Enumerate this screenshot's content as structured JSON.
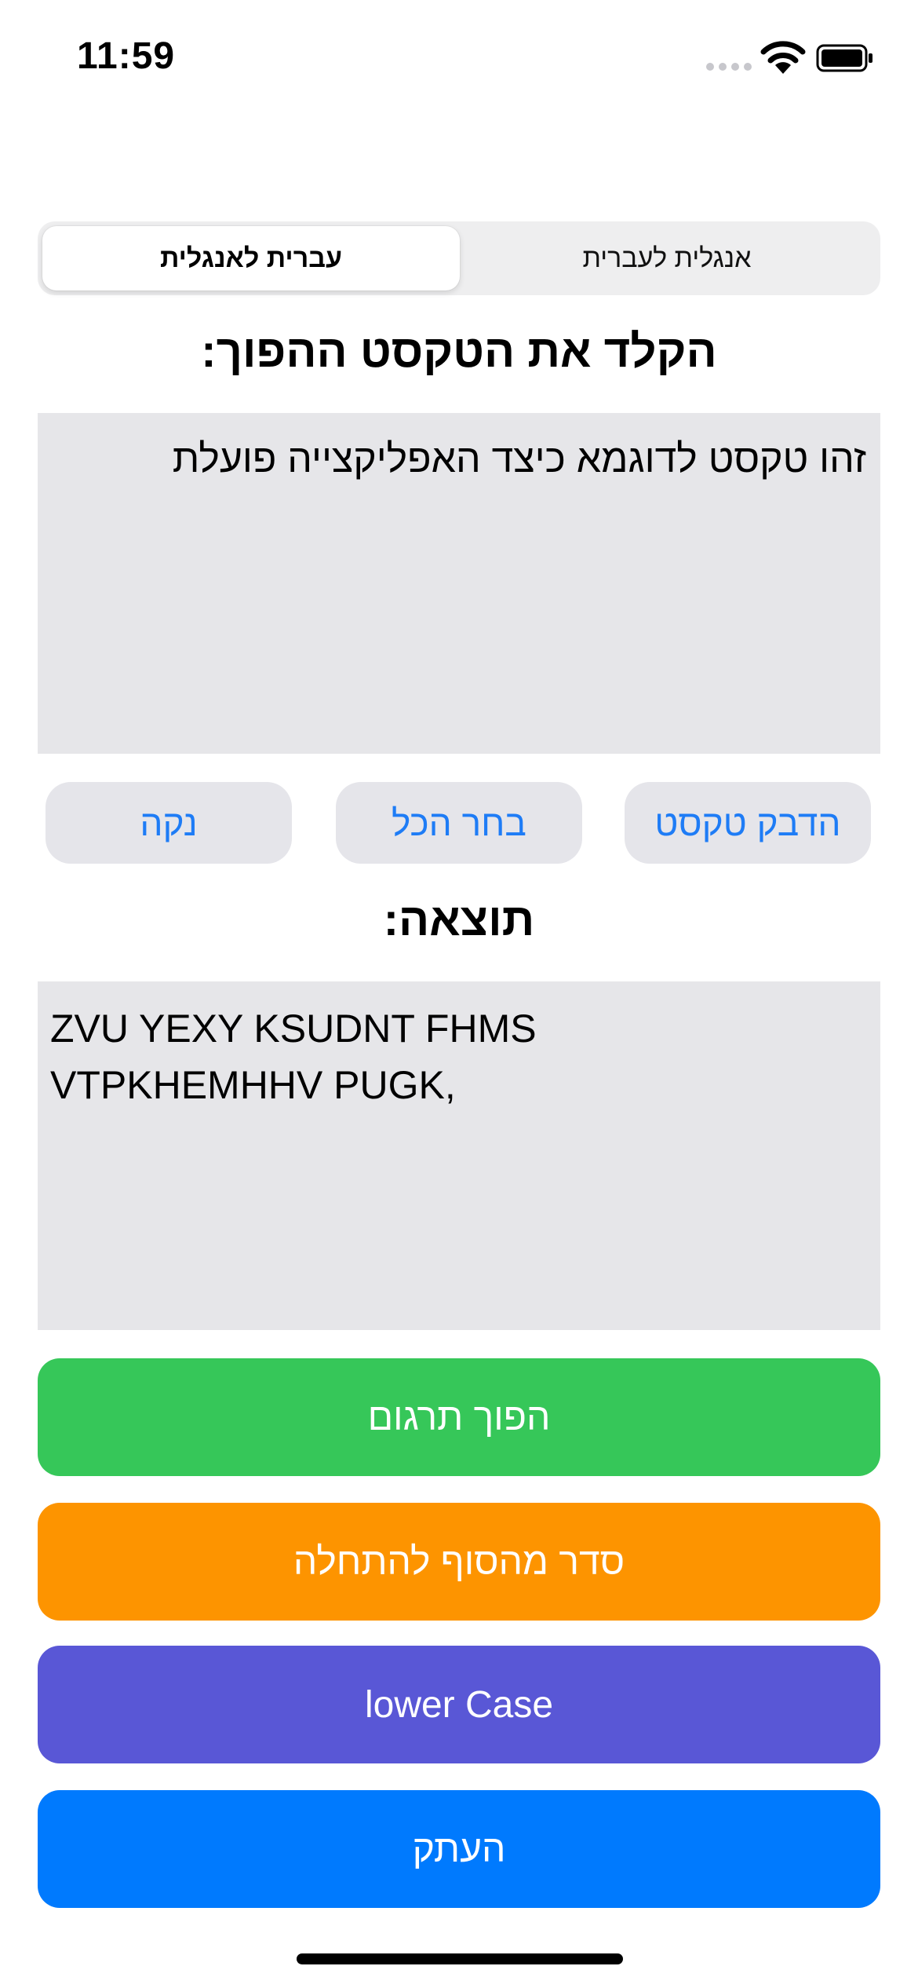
{
  "status_bar": {
    "time": "11:59"
  },
  "segmented_control": {
    "selected": "עברית לאנגלית",
    "other": "אנגלית לעברית"
  },
  "input_section": {
    "heading": "הקלד את הטקסט ההפוך:",
    "text": "זהו טקסט לדוגמא כיצד האפליקצייה פועלת"
  },
  "action_buttons": {
    "paste": "הדבק טקסט",
    "select_all": "בחר הכל",
    "clear": "נקה"
  },
  "result_section": {
    "heading": "תוצאה:",
    "line1": "ZVU YEXY KSUDNT FHMS",
    "line2": "VTPKHEMHHV PUGK,"
  },
  "main_buttons": {
    "reverse_translation": "הפוך תרגום",
    "reverse_order": "סדר מהסוף להתחלה",
    "lower_case": "lower Case",
    "copy": "העתק"
  },
  "colors": {
    "green": "#36c759",
    "orange": "#fd9400",
    "purple": "#5957d6",
    "blue": "#007afe",
    "link_blue": "#1e7cf6",
    "textbox_gray": "#e6e6e9"
  }
}
